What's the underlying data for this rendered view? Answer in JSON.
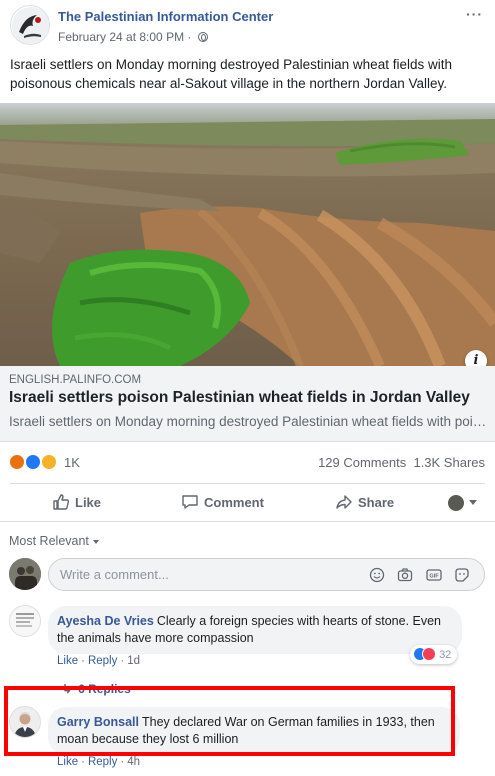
{
  "post": {
    "page_name": "The Palestinian Information Center",
    "timestamp": "February 24 at 8:00 PM",
    "meta_separator": "·",
    "more_label": "···",
    "text": "Israeli settlers on Monday morning destroyed Palestinian wheat fields with poisonous chemicals near al-Sakout village in the northern Jordan Valley.",
    "icons": {
      "privacy": "globe-icon",
      "more": "more-dots-icon"
    }
  },
  "link_preview": {
    "info_label": "i",
    "domain": "ENGLISH.PALINFO.COM",
    "title": "Israeli settlers poison Palestinian wheat fields in Jordan Valley",
    "description": "Israeli settlers on Monday morning destroyed Palestinian wheat fields with poisonous chemicals near al-Sakout village in the northern Jordan Valley."
  },
  "engagement": {
    "reaction_icons": [
      "angry-reaction-icon",
      "like-reaction-icon",
      "sad-reaction-icon"
    ],
    "reaction_count": "1K",
    "comments_count": "129 Comments",
    "shares_count": "1.3K Shares"
  },
  "actions": {
    "like": "Like",
    "comment": "Comment",
    "share": "Share"
  },
  "comments_section": {
    "sort_label": "Most Relevant",
    "composer_placeholder": "Write a comment...",
    "composer_icons": [
      "emoji-icon",
      "camera-icon",
      "gif-icon",
      "sticker-icon"
    ],
    "gif_label": "GIF"
  },
  "comments": [
    {
      "author": "Ayesha De Vries",
      "text": "Clearly a foreign species with hearts of stone. Even the animals have more compassion",
      "like_label": "Like",
      "reply_label": "Reply",
      "time": "1d",
      "reaction_count": "32",
      "replies_label": "6 Replies"
    },
    {
      "author": "Garry Bonsall",
      "text": "They declared War on German families in 1933, then moan because they lost 6 million",
      "like_label": "Like",
      "reply_label": "Reply",
      "time": "4h"
    }
  ],
  "colors": {
    "link_blue": "#385898",
    "highlight_red": "#ff0000",
    "like_blue": "#2078f4",
    "angry_orange": "#e9710f",
    "sad_yellow": "#f7b125",
    "love_red": "#f33e58"
  }
}
